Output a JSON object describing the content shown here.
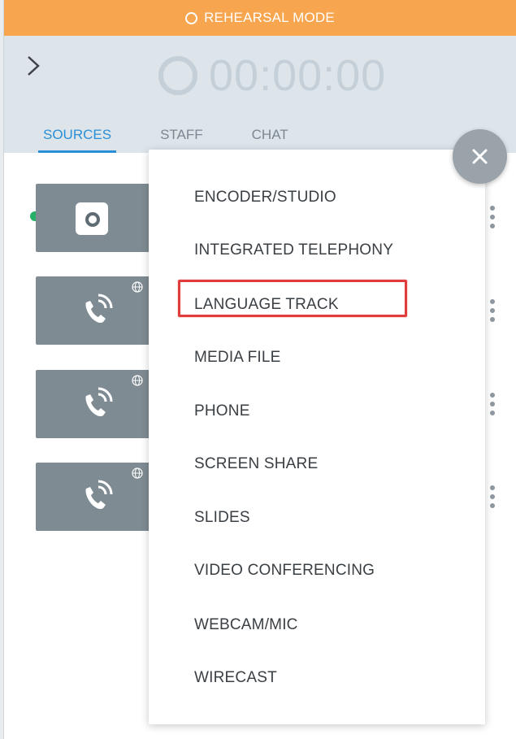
{
  "banner": {
    "label": "REHEARSAL MODE"
  },
  "timer": {
    "value": "00:00:00"
  },
  "tabs": [
    {
      "label": "SOURCES",
      "active": true
    },
    {
      "label": "STAFF",
      "active": false
    },
    {
      "label": "CHAT",
      "active": false
    }
  ],
  "menu": {
    "items": [
      {
        "label": "ENCODER/STUDIO"
      },
      {
        "label": "INTEGRATED TELEPHONY"
      },
      {
        "label": "LANGUAGE TRACK",
        "highlighted": true
      },
      {
        "label": "MEDIA FILE"
      },
      {
        "label": "PHONE"
      },
      {
        "label": "SCREEN SHARE"
      },
      {
        "label": "SLIDES"
      },
      {
        "label": "VIDEO CONFERENCING"
      },
      {
        "label": "WEBCAM/MIC"
      },
      {
        "label": "WIRECAST"
      }
    ]
  },
  "icons": {
    "expand": "chevron-right-icon",
    "close": "close-icon",
    "camera": "camera-icon",
    "phone": "phone-ringing-icon",
    "globe": "globe-icon",
    "more": "more-vertical-icon"
  },
  "colors": {
    "banner": "#f7a54e",
    "header": "#dde5eb",
    "accent": "#2a8fd6",
    "highlight": "#e03c3c",
    "live_dot": "#27b067"
  }
}
